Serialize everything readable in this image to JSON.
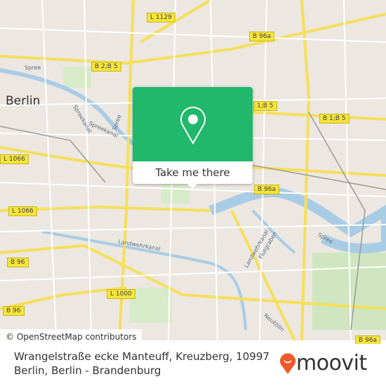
{
  "map": {
    "city_label": "Berlin",
    "road_shields": [
      "L 1129",
      "B 96a",
      "B 2;B 5",
      "1;B 5",
      "B 1;B 5",
      "L 1066",
      "B 96a",
      "L 1066",
      "B 96",
      "L 1000",
      "B 96",
      "B 96a"
    ],
    "street_labels": [
      "Spree",
      "Spreekanal",
      "Spreekanal",
      "Spree",
      "Landwehrkanal",
      "Landwehrkanal",
      "Flutgraben",
      "Neukölln",
      "Spree"
    ],
    "attribution": "© OpenStreetMap contributors"
  },
  "popup": {
    "icon": "map-pin-icon",
    "button_label": "Take me there",
    "accent_color": "#20b86a"
  },
  "footer": {
    "address": "Wrangelstraße ecke Manteuff, Kreuzberg, 10997 Berlin, Berlin - Brandenburg",
    "brand": "moovit",
    "brand_color": "#f05a28"
  }
}
